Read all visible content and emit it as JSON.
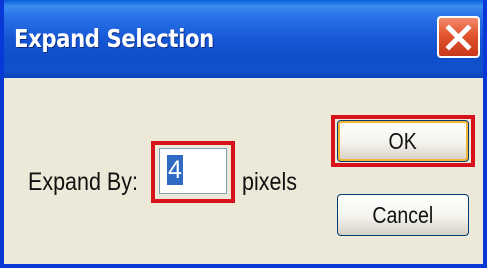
{
  "dialog": {
    "title": "Expand Selection",
    "close_icon": "close-icon"
  },
  "form": {
    "expand_label": "Expand By:",
    "value": "4",
    "unit_label": "pixels"
  },
  "buttons": {
    "ok_label": "OK",
    "cancel_label": "Cancel"
  },
  "colors": {
    "titlebar": "#1657d6",
    "close_button": "#e2542e",
    "highlight": "#d8121b",
    "selection": "#316ac5",
    "dialog_body": "#ece9d8"
  }
}
